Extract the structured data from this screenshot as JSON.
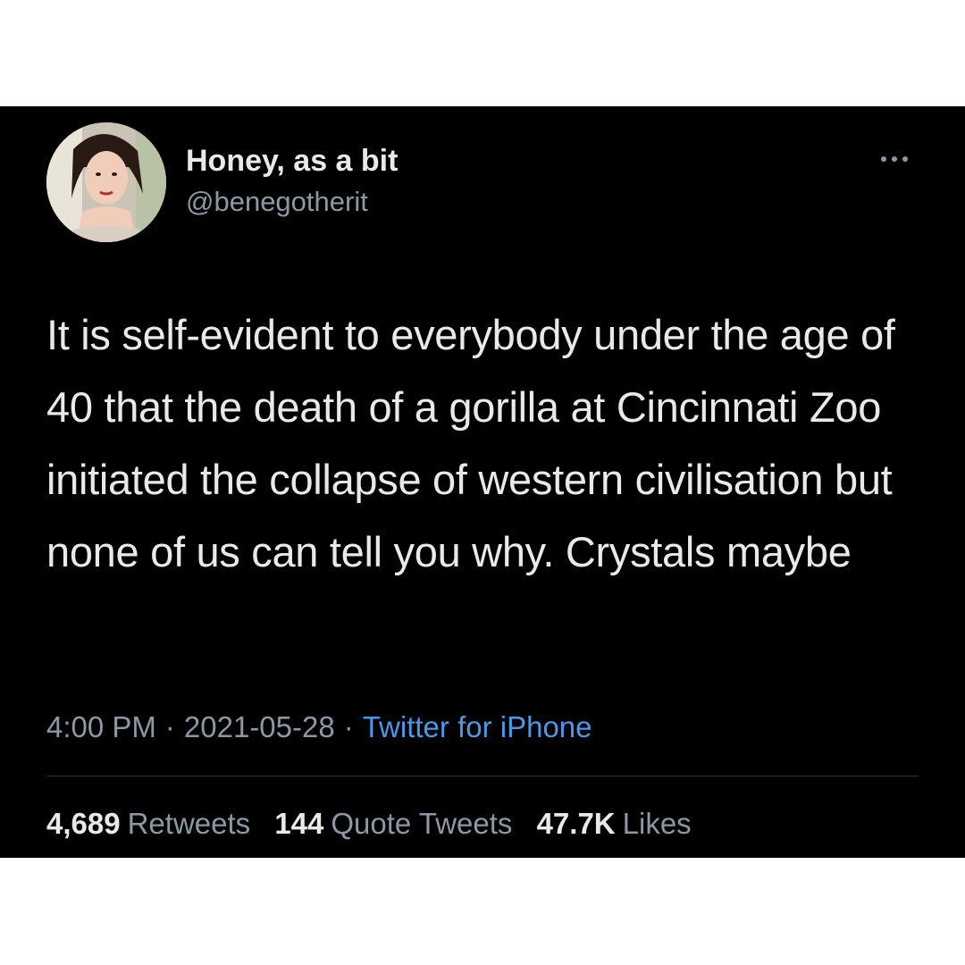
{
  "tweet": {
    "display_name": "Honey, as a bit",
    "handle": "@benegotherit",
    "text": "It is self-evident to everybody under the age of 40 that the death of a gorilla at Cincinnati Zoo initiated the collapse of western civilisation but none of us can tell you why. Crystals maybe",
    "time": "4:00 PM",
    "separator": "·",
    "date": "2021-05-28",
    "source": "Twitter for iPhone"
  },
  "stats": {
    "retweets_count": "4,689",
    "retweets_label": "Retweets",
    "quote_tweets_count": "144",
    "quote_tweets_label": "Quote Tweets",
    "likes_count": "47.7K",
    "likes_label": "Likes"
  },
  "icons": {
    "more": "more-options-icon"
  },
  "colors": {
    "background": "#000000",
    "text_primary": "#e7e9ea",
    "text_secondary": "#8b98a5",
    "link": "#4a99e9"
  }
}
